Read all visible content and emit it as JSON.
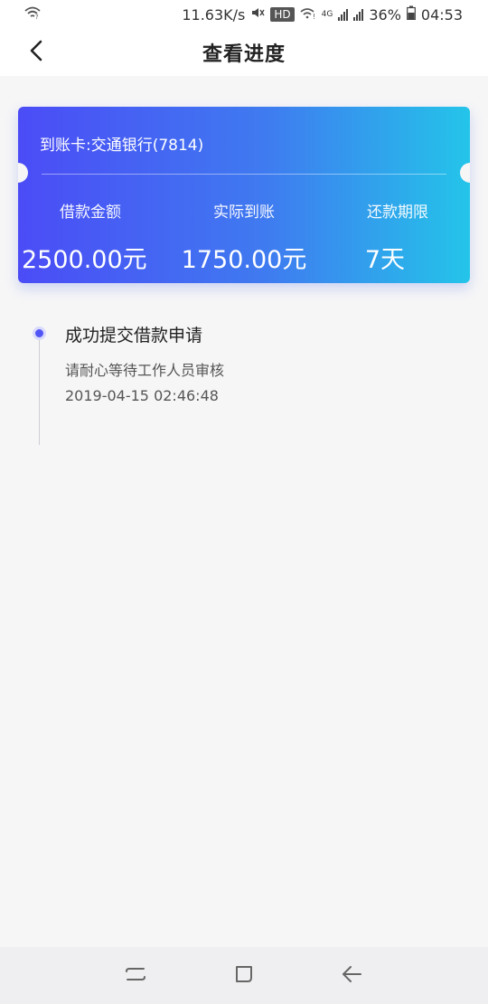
{
  "status_bar": {
    "speed": "11.63K/s",
    "hd": "HD",
    "network": "4G",
    "battery": "36%",
    "time": "04:53"
  },
  "nav": {
    "title": "查看进度"
  },
  "card": {
    "header": "到账卡:交通银行(7814)",
    "columns": [
      {
        "label": "借款金额",
        "value": "2500.00元"
      },
      {
        "label": "实际到账",
        "value": "1750.00元"
      },
      {
        "label": "还款期限",
        "value": "7天"
      }
    ],
    "gradient_start": "#4b4cf6",
    "gradient_end": "#24c4e9"
  },
  "timeline": {
    "items": [
      {
        "title": "成功提交借款申请",
        "subtitle": "请耐心等待工作人员审核",
        "time": "2019-04-15 02:46:48"
      }
    ],
    "dot_color": "#5255f5"
  },
  "icons": {
    "back": "chevron-left-icon",
    "recent": "recent-apps-icon",
    "home": "home-icon",
    "nav_back": "back-arrow-icon"
  }
}
